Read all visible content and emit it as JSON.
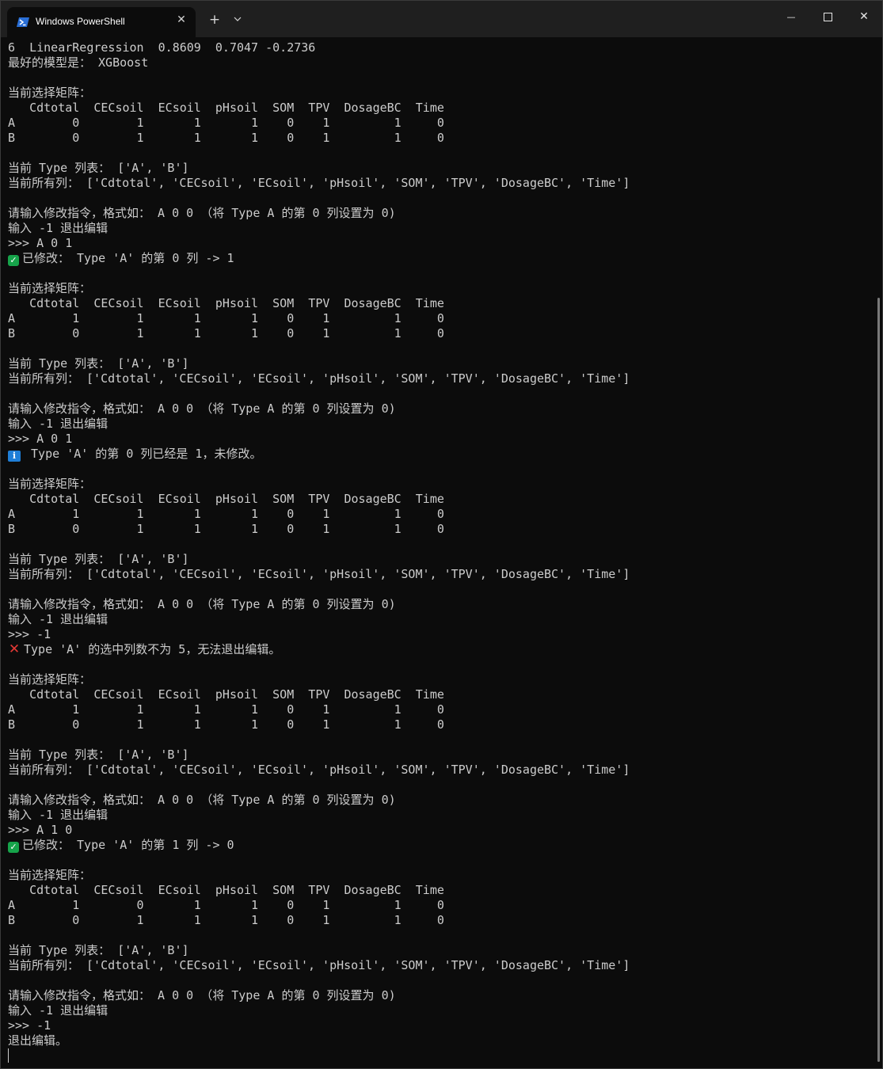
{
  "window": {
    "tab_title": "Windows PowerShell",
    "tab_close": "✕",
    "new_tab": "+",
    "dropdown": "⌄",
    "minimize": "—",
    "close": "✕"
  },
  "icons": {
    "tab_icon": "powershell-icon",
    "ok": "check-mark-icon",
    "info": "info-icon",
    "error": "cross-mark-icon"
  },
  "colors": {
    "background": "#0c0c0c",
    "foreground": "#cccccc",
    "titlebar": "#1f1f1f",
    "ok": "#16a34a",
    "info": "#1f7ed6",
    "error": "#e53935"
  },
  "terminal": {
    "lines": [
      {
        "text": "6  LinearRegression  0.8609  0.7047 -0.2736"
      },
      {
        "text": "最好的模型是： XGBoost"
      },
      {
        "text": ""
      },
      {
        "text": "当前选择矩阵："
      },
      {
        "text": "   Cdtotal  CECsoil  ECsoil  pHsoil  SOM  TPV  DosageBC  Time"
      },
      {
        "text": "A        0        1       1       1    0    1         1     0"
      },
      {
        "text": "B        0        1       1       1    0    1         1     0"
      },
      {
        "text": ""
      },
      {
        "text": "当前 Type 列表： ['A', 'B']"
      },
      {
        "text": "当前所有列： ['Cdtotal', 'CECsoil', 'ECsoil', 'pHsoil', 'SOM', 'TPV', 'DosageBC', 'Time']"
      },
      {
        "text": ""
      },
      {
        "text": "请输入修改指令，格式如： A 0 0 （将 Type A 的第 0 列设置为 0)"
      },
      {
        "text": "输入 -1 退出编辑"
      },
      {
        "text": ">>> A 0 1"
      },
      {
        "icon": "ok",
        "text": "已修改： Type 'A' 的第 0 列 -> 1"
      },
      {
        "text": ""
      },
      {
        "text": "当前选择矩阵："
      },
      {
        "text": "   Cdtotal  CECsoil  ECsoil  pHsoil  SOM  TPV  DosageBC  Time"
      },
      {
        "text": "A        1        1       1       1    0    1         1     0"
      },
      {
        "text": "B        0        1       1       1    0    1         1     0"
      },
      {
        "text": ""
      },
      {
        "text": "当前 Type 列表： ['A', 'B']"
      },
      {
        "text": "当前所有列： ['Cdtotal', 'CECsoil', 'ECsoil', 'pHsoil', 'SOM', 'TPV', 'DosageBC', 'Time']"
      },
      {
        "text": ""
      },
      {
        "text": "请输入修改指令，格式如： A 0 0 （将 Type A 的第 0 列设置为 0)"
      },
      {
        "text": "输入 -1 退出编辑"
      },
      {
        "text": ">>> A 0 1"
      },
      {
        "icon": "info",
        "text": " Type 'A' 的第 0 列已经是 1，未修改。"
      },
      {
        "text": ""
      },
      {
        "text": "当前选择矩阵："
      },
      {
        "text": "   Cdtotal  CECsoil  ECsoil  pHsoil  SOM  TPV  DosageBC  Time"
      },
      {
        "text": "A        1        1       1       1    0    1         1     0"
      },
      {
        "text": "B        0        1       1       1    0    1         1     0"
      },
      {
        "text": ""
      },
      {
        "text": "当前 Type 列表： ['A', 'B']"
      },
      {
        "text": "当前所有列： ['Cdtotal', 'CECsoil', 'ECsoil', 'pHsoil', 'SOM', 'TPV', 'DosageBC', 'Time']"
      },
      {
        "text": ""
      },
      {
        "text": "请输入修改指令，格式如： A 0 0 （将 Type A 的第 0 列设置为 0)"
      },
      {
        "text": "输入 -1 退出编辑"
      },
      {
        "text": ">>> -1"
      },
      {
        "icon": "error",
        "text": "Type 'A' 的选中列数不为 5，无法退出编辑。"
      },
      {
        "text": ""
      },
      {
        "text": "当前选择矩阵："
      },
      {
        "text": "   Cdtotal  CECsoil  ECsoil  pHsoil  SOM  TPV  DosageBC  Time"
      },
      {
        "text": "A        1        1       1       1    0    1         1     0"
      },
      {
        "text": "B        0        1       1       1    0    1         1     0"
      },
      {
        "text": ""
      },
      {
        "text": "当前 Type 列表： ['A', 'B']"
      },
      {
        "text": "当前所有列： ['Cdtotal', 'CECsoil', 'ECsoil', 'pHsoil', 'SOM', 'TPV', 'DosageBC', 'Time']"
      },
      {
        "text": ""
      },
      {
        "text": "请输入修改指令，格式如： A 0 0 （将 Type A 的第 0 列设置为 0)"
      },
      {
        "text": "输入 -1 退出编辑"
      },
      {
        "text": ">>> A 1 0"
      },
      {
        "icon": "ok",
        "text": "已修改： Type 'A' 的第 1 列 -> 0"
      },
      {
        "text": ""
      },
      {
        "text": "当前选择矩阵："
      },
      {
        "text": "   Cdtotal  CECsoil  ECsoil  pHsoil  SOM  TPV  DosageBC  Time"
      },
      {
        "text": "A        1        0       1       1    0    1         1     0"
      },
      {
        "text": "B        0        1       1       1    0    1         1     0"
      },
      {
        "text": ""
      },
      {
        "text": "当前 Type 列表： ['A', 'B']"
      },
      {
        "text": "当前所有列： ['Cdtotal', 'CECsoil', 'ECsoil', 'pHsoil', 'SOM', 'TPV', 'DosageBC', 'Time']"
      },
      {
        "text": ""
      },
      {
        "text": "请输入修改指令，格式如： A 0 0 （将 Type A 的第 0 列设置为 0)"
      },
      {
        "text": "输入 -1 退出编辑"
      },
      {
        "text": ">>> -1"
      },
      {
        "text": "退出编辑。"
      }
    ]
  }
}
